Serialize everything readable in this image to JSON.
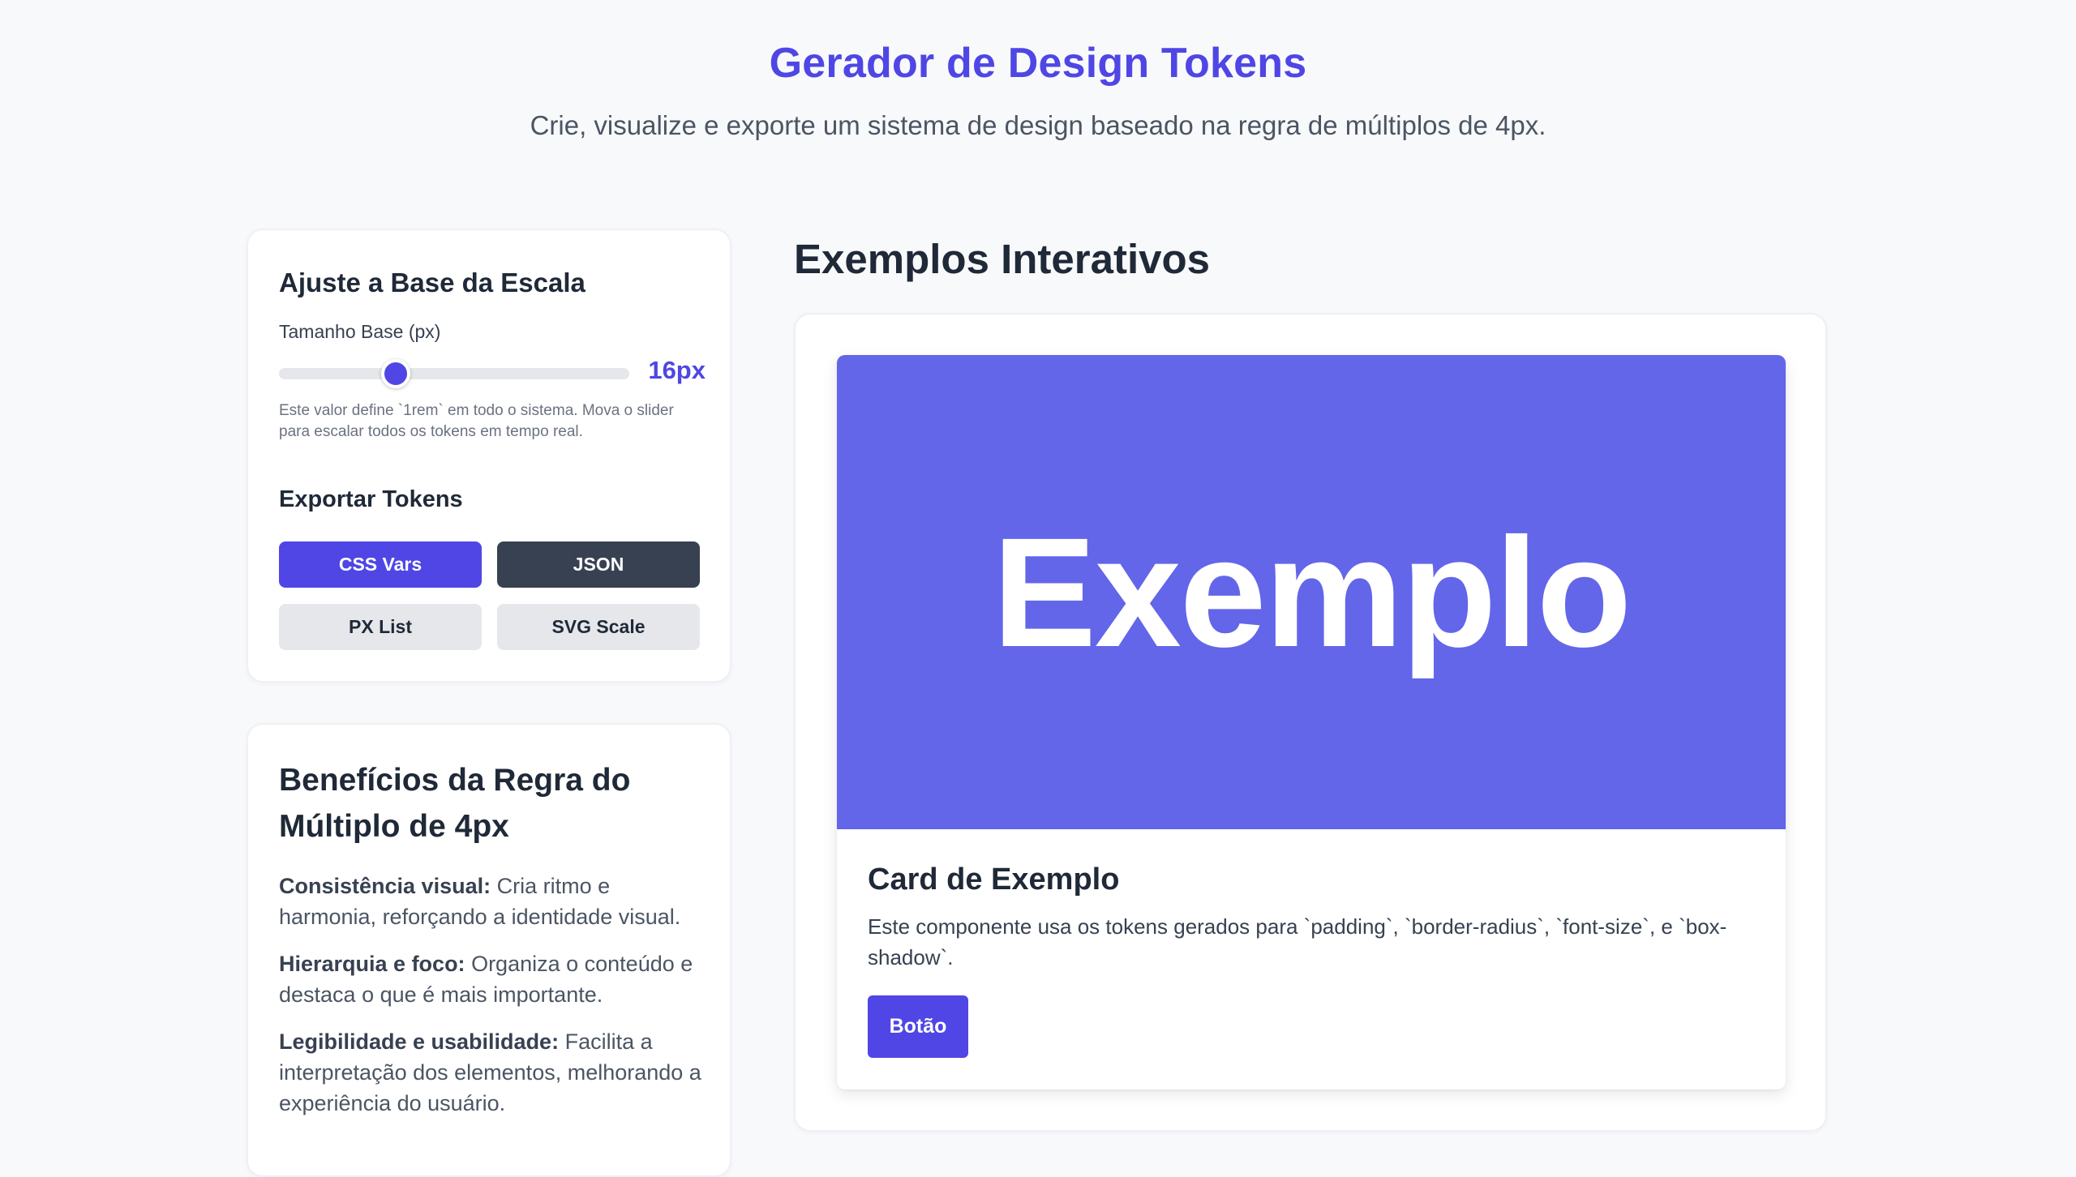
{
  "header": {
    "title": "Gerador de Design Tokens",
    "subtitle": "Crie, visualize e exporte um sistema de design baseado na regra de múltiplos de 4px."
  },
  "controls": {
    "title": "Ajuste a Base da Escala",
    "base_label": "Tamanho Base (px)",
    "base_value_display": "16px",
    "base_value": 16,
    "help_text": "Este valor define `1rem` em todo o sistema. Mova o slider para escalar todos os tokens em tempo real.",
    "export_title": "Exportar Tokens",
    "buttons": {
      "css_vars": "CSS Vars",
      "json": "JSON",
      "px_list": "PX List",
      "svg_scale": "SVG Scale"
    }
  },
  "benefits": {
    "title": "Benefícios da Regra do Múltiplo de 4px",
    "items": [
      {
        "label": "Consistência visual:",
        "text": " Cria ritmo e harmonia, reforçando a identidade visual."
      },
      {
        "label": "Hierarquia e foco:",
        "text": " Organiza o conteúdo e destaca o que é mais importante."
      },
      {
        "label": "Legibilidade e usabilidade:",
        "text": " Facilita a interpretação dos elementos, melhorando a experiência do usuário."
      }
    ]
  },
  "examples": {
    "title": "Exemplos Interativos",
    "card": {
      "media_text": "Exemplo",
      "title": "Card de Exemplo",
      "text": "Este componente usa os tokens gerados para `padding`, `border-radius`, `font-size`, e `box-shadow`.",
      "button_label": "Botão"
    }
  },
  "colors": {
    "accent": "#4f46e5",
    "media_bg": "#6366e9",
    "dark_button": "#374151",
    "light_button": "#e5e7eb",
    "page_bg": "#f8f9fb"
  }
}
